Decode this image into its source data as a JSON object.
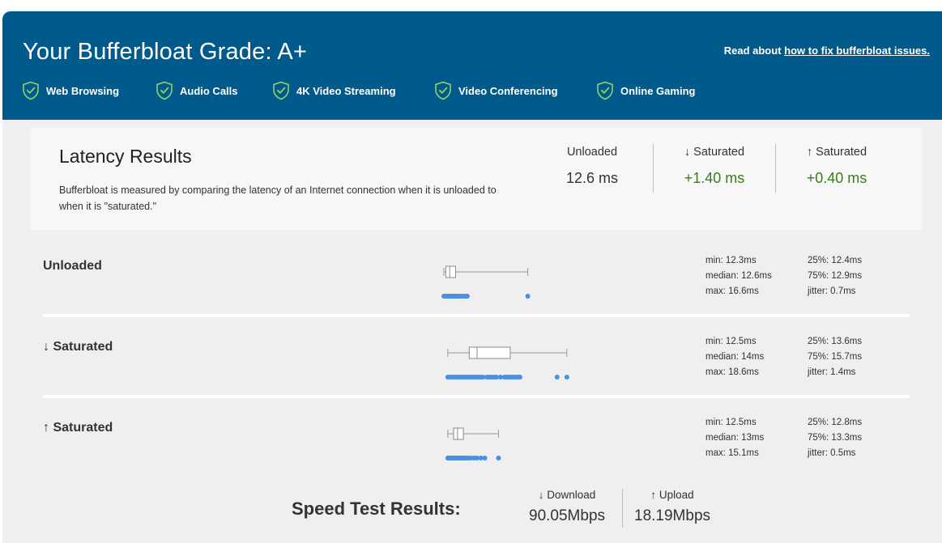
{
  "header": {
    "grade_title": "Your Bufferbloat Grade: A+",
    "read_prefix": "Read about ",
    "read_link": "how to fix bufferbloat issues.",
    "check_icon": "shield-check-icon",
    "check_color": "#8ed16e",
    "uses": [
      "Web Browsing",
      "Audio Calls",
      "4K Video Streaming",
      "Video Conferencing",
      "Online Gaming"
    ]
  },
  "latency": {
    "title": "Latency Results",
    "description": "Bufferbloat is measured by comparing the latency of an Internet connection when it is unloaded to when it is \"saturated.\"",
    "unloaded": {
      "label": "Unloaded",
      "value": "12.6 ms"
    },
    "down": {
      "label": "↓ Saturated",
      "value": "+1.40 ms"
    },
    "up": {
      "label": "↑ Saturated",
      "value": "+0.40 ms"
    }
  },
  "rows": [
    {
      "label": "Unloaded",
      "min": "min: 12.3ms",
      "median": "median: 12.6ms",
      "max": "max: 16.6ms",
      "p25": "25%: 12.4ms",
      "p75": "75%: 12.9ms",
      "jitter": "jitter: 0.7ms"
    },
    {
      "label": "↓ Saturated",
      "min": "min: 12.5ms",
      "median": "median: 14ms",
      "max": "max: 18.6ms",
      "p25": "25%: 13.6ms",
      "p75": "75%: 15.7ms",
      "jitter": "jitter: 1.4ms"
    },
    {
      "label": "↑ Saturated",
      "min": "min: 12.5ms",
      "median": "median: 13ms",
      "max": "max: 15.1ms",
      "p25": "25%: 12.8ms",
      "p75": "75%: 13.3ms",
      "jitter": "jitter: 0.5ms"
    }
  ],
  "box_data": [
    {
      "min": 12.3,
      "q1": 12.4,
      "median": 12.6,
      "q3": 12.9,
      "max": 16.6,
      "samples": [
        12.3,
        12.35,
        12.4,
        12.42,
        12.45,
        12.5,
        12.52,
        12.55,
        12.6,
        12.62,
        12.65,
        12.7,
        12.75,
        12.8,
        12.85,
        12.9,
        12.95,
        13.0,
        13.05,
        13.1,
        13.2,
        13.25,
        13.3,
        13.4,
        13.45,
        13.5,
        16.6
      ]
    },
    {
      "min": 12.5,
      "q1": 13.6,
      "median": 14,
      "q3": 15.7,
      "max": 18.6,
      "samples": [
        12.5,
        12.6,
        12.7,
        12.8,
        12.9,
        13.0,
        13.1,
        13.2,
        13.3,
        13.4,
        13.5,
        13.6,
        13.7,
        13.8,
        13.9,
        14.0,
        14.1,
        14.2,
        14.3,
        14.5,
        14.6,
        14.7,
        14.8,
        14.9,
        15.0,
        15.2,
        15.4,
        15.5,
        15.6,
        15.7,
        15.8,
        15.9,
        16.0,
        16.1,
        16.2,
        18.1,
        18.6
      ]
    },
    {
      "min": 12.5,
      "q1": 12.8,
      "median": 13,
      "q3": 13.3,
      "max": 15.1,
      "samples": [
        12.5,
        12.55,
        12.6,
        12.65,
        12.7,
        12.75,
        12.8,
        12.85,
        12.9,
        12.95,
        13.0,
        13.05,
        13.1,
        13.15,
        13.2,
        13.25,
        13.3,
        13.35,
        13.4,
        13.5,
        13.6,
        13.7,
        13.85,
        14.0,
        14.2,
        14.4,
        15.1
      ]
    }
  ],
  "speed": {
    "title": "Speed Test Results:",
    "download_label": "↓ Download",
    "download_value": "90.05Mbps",
    "upload_label": "↑ Upload",
    "upload_value": "18.19Mbps"
  },
  "colors": {
    "header_bg": "#005a8c",
    "good": "#3a7d1e",
    "dots": "#4a90e2"
  }
}
